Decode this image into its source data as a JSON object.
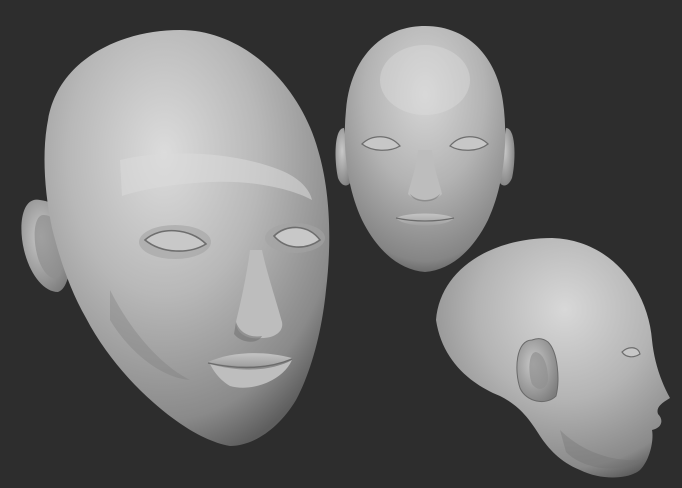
{
  "scene": {
    "background_color": "#2d2d2d",
    "material_color": "#b9b9b9",
    "highlight_color": "#dedede",
    "shadow_color": "#6a6a6a",
    "views": [
      {
        "name": "three-quarter-view"
      },
      {
        "name": "front-view"
      },
      {
        "name": "side-view"
      }
    ]
  }
}
